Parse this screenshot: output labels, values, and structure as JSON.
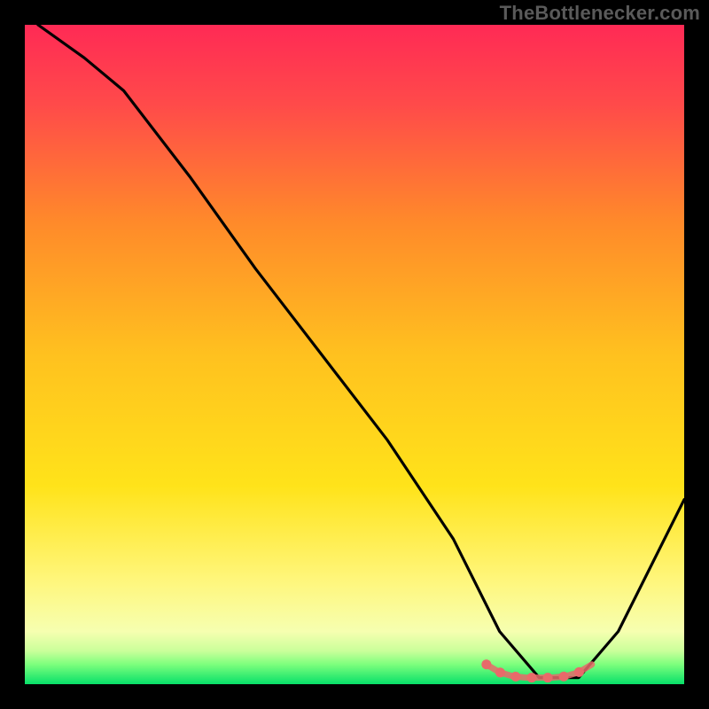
{
  "watermark": "TheBottlenecker.com",
  "colors": {
    "top": "#ff2a55",
    "mid": "#ffd400",
    "bottom": "#07e069",
    "curve": "#000000",
    "accent": "#e86a6a",
    "frame": "#000000"
  },
  "chart_data": {
    "type": "line",
    "title": "",
    "xlabel": "",
    "ylabel": "",
    "xlim": [
      0,
      100
    ],
    "ylim": [
      0,
      100
    ],
    "series": [
      {
        "name": "curve",
        "x": [
          2,
          9,
          15,
          25,
          35,
          45,
          55,
          65,
          72,
          78,
          84,
          90,
          100
        ],
        "y": [
          100,
          95,
          90,
          77,
          63,
          50,
          37,
          22,
          8,
          1,
          1,
          8,
          28
        ]
      },
      {
        "name": "accent",
        "x": [
          70,
          72,
          74,
          76,
          78,
          80,
          82,
          84,
          86
        ],
        "y": [
          3.0,
          1.8,
          1.2,
          1.0,
          1.0,
          1.0,
          1.2,
          1.8,
          3.0
        ]
      }
    ]
  }
}
